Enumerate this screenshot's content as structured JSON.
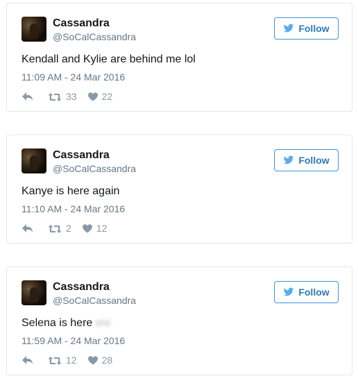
{
  "tweets": [
    {
      "name": "Cassandra",
      "handle": "@SoCalCassandra",
      "follow_label": "Follow",
      "text": "Kendall and Kylie are behind me lol",
      "blurred_text": "",
      "timestamp": "11:09 AM - 24 Mar 2016",
      "retweets": "33",
      "likes": "22"
    },
    {
      "name": "Cassandra",
      "handle": "@SoCalCassandra",
      "follow_label": "Follow",
      "text": "Kanye is here again",
      "blurred_text": "",
      "timestamp": "11:10 AM - 24 Mar 2016",
      "retweets": "2",
      "likes": "12"
    },
    {
      "name": "Cassandra",
      "handle": "@SoCalCassandra",
      "follow_label": "Follow",
      "text": "Selena is here",
      "blurred_text": "shit",
      "timestamp": "11:59 AM - 24 Mar 2016",
      "retweets": "12",
      "likes": "28"
    }
  ],
  "icons": {
    "follow": "twitter-bird-icon",
    "reply": "reply-icon",
    "retweet": "retweet-icon",
    "like": "heart-icon"
  },
  "colors": {
    "accent": "#55acee",
    "follow_text": "#2b7bb9",
    "muted": "#8899a6",
    "border": "#e1e8ed"
  }
}
